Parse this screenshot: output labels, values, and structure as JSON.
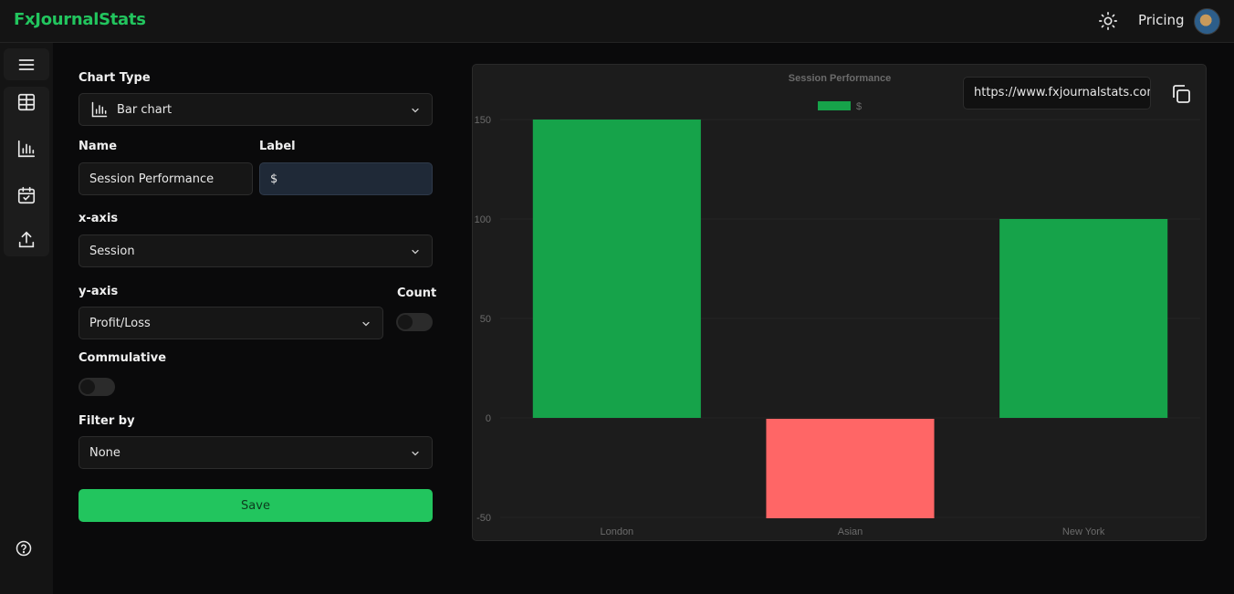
{
  "header": {
    "brand": "FxJournalStats",
    "pricing": "Pricing"
  },
  "sidebar": {
    "icons": [
      "menu-icon",
      "table-icon",
      "bar-chart-icon",
      "calendar-check-icon",
      "upload-icon",
      "help-icon"
    ]
  },
  "form": {
    "chart_type_label": "Chart Type",
    "chart_type_value": "Bar chart",
    "name_label": "Name",
    "name_value": "Session Performance",
    "label_label": "Label",
    "label_value": "$",
    "xaxis_label": "x-axis",
    "xaxis_value": "Session",
    "yaxis_label": "y-axis",
    "yaxis_value": "Profit/Loss",
    "count_label": "Count",
    "commulative_label": "Commulative",
    "filter_label": "Filter by",
    "filter_value": "None",
    "save_label": "Save"
  },
  "share": {
    "url": "https://www.fxjournalstats.com"
  },
  "colors": {
    "accent": "#22c55e",
    "positive_bar": "#16a34a",
    "negative_bar": "#ff6666"
  },
  "chart_data": {
    "type": "bar",
    "title": "Session Performance",
    "categories": [
      "London",
      "Asian",
      "New York"
    ],
    "series": [
      {
        "name": "$",
        "values": [
          150,
          -50,
          100
        ]
      }
    ],
    "ylim": [
      -50,
      150
    ],
    "yticks": [
      150,
      100,
      50,
      0,
      -50
    ],
    "xlabel": "",
    "ylabel": "",
    "legend": "top"
  }
}
